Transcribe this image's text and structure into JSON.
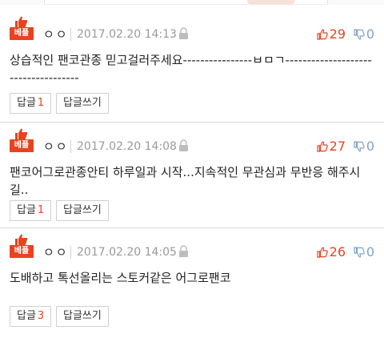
{
  "comments": [
    {
      "badge": "베플",
      "nickname": "ㅇㅇ",
      "date": "2017.02.20 14:13",
      "likes": "29",
      "dislikes": "0",
      "text": "상습적인 팬코관종 믿고걸러주세요----------------ㅂㅁㄱ------------------------------------",
      "reply_label": "답글",
      "reply_count": "1",
      "write_reply_label": "답글쓰기"
    },
    {
      "badge": "베플",
      "nickname": "ㅇㅇ",
      "date": "2017.02.20 14:08",
      "likes": "27",
      "dislikes": "0",
      "text": "팬코어그로관종안티 하루일과 시작...지속적인 무관심과 무반응 해주시길..",
      "reply_label": "답글",
      "reply_count": "1",
      "write_reply_label": "답글쓰기"
    },
    {
      "badge": "베플",
      "nickname": "ㅇㅇ",
      "date": "2017.02.20 14:05",
      "likes": "26",
      "dislikes": "0",
      "text": "도배하고 톡선올리는 스토커같은 어그로팬코",
      "reply_label": "답글",
      "reply_count": "3",
      "write_reply_label": "답글쓰기"
    }
  ],
  "icons": {
    "best": "thumbs-up-badge-icon",
    "lock": "lock-icon",
    "like": "thumbs-up-icon",
    "dislike": "thumbs-down-icon"
  },
  "colors": {
    "accent": "#e8431f",
    "dislike": "#7fa3c8",
    "meta": "#9a9a9a"
  }
}
